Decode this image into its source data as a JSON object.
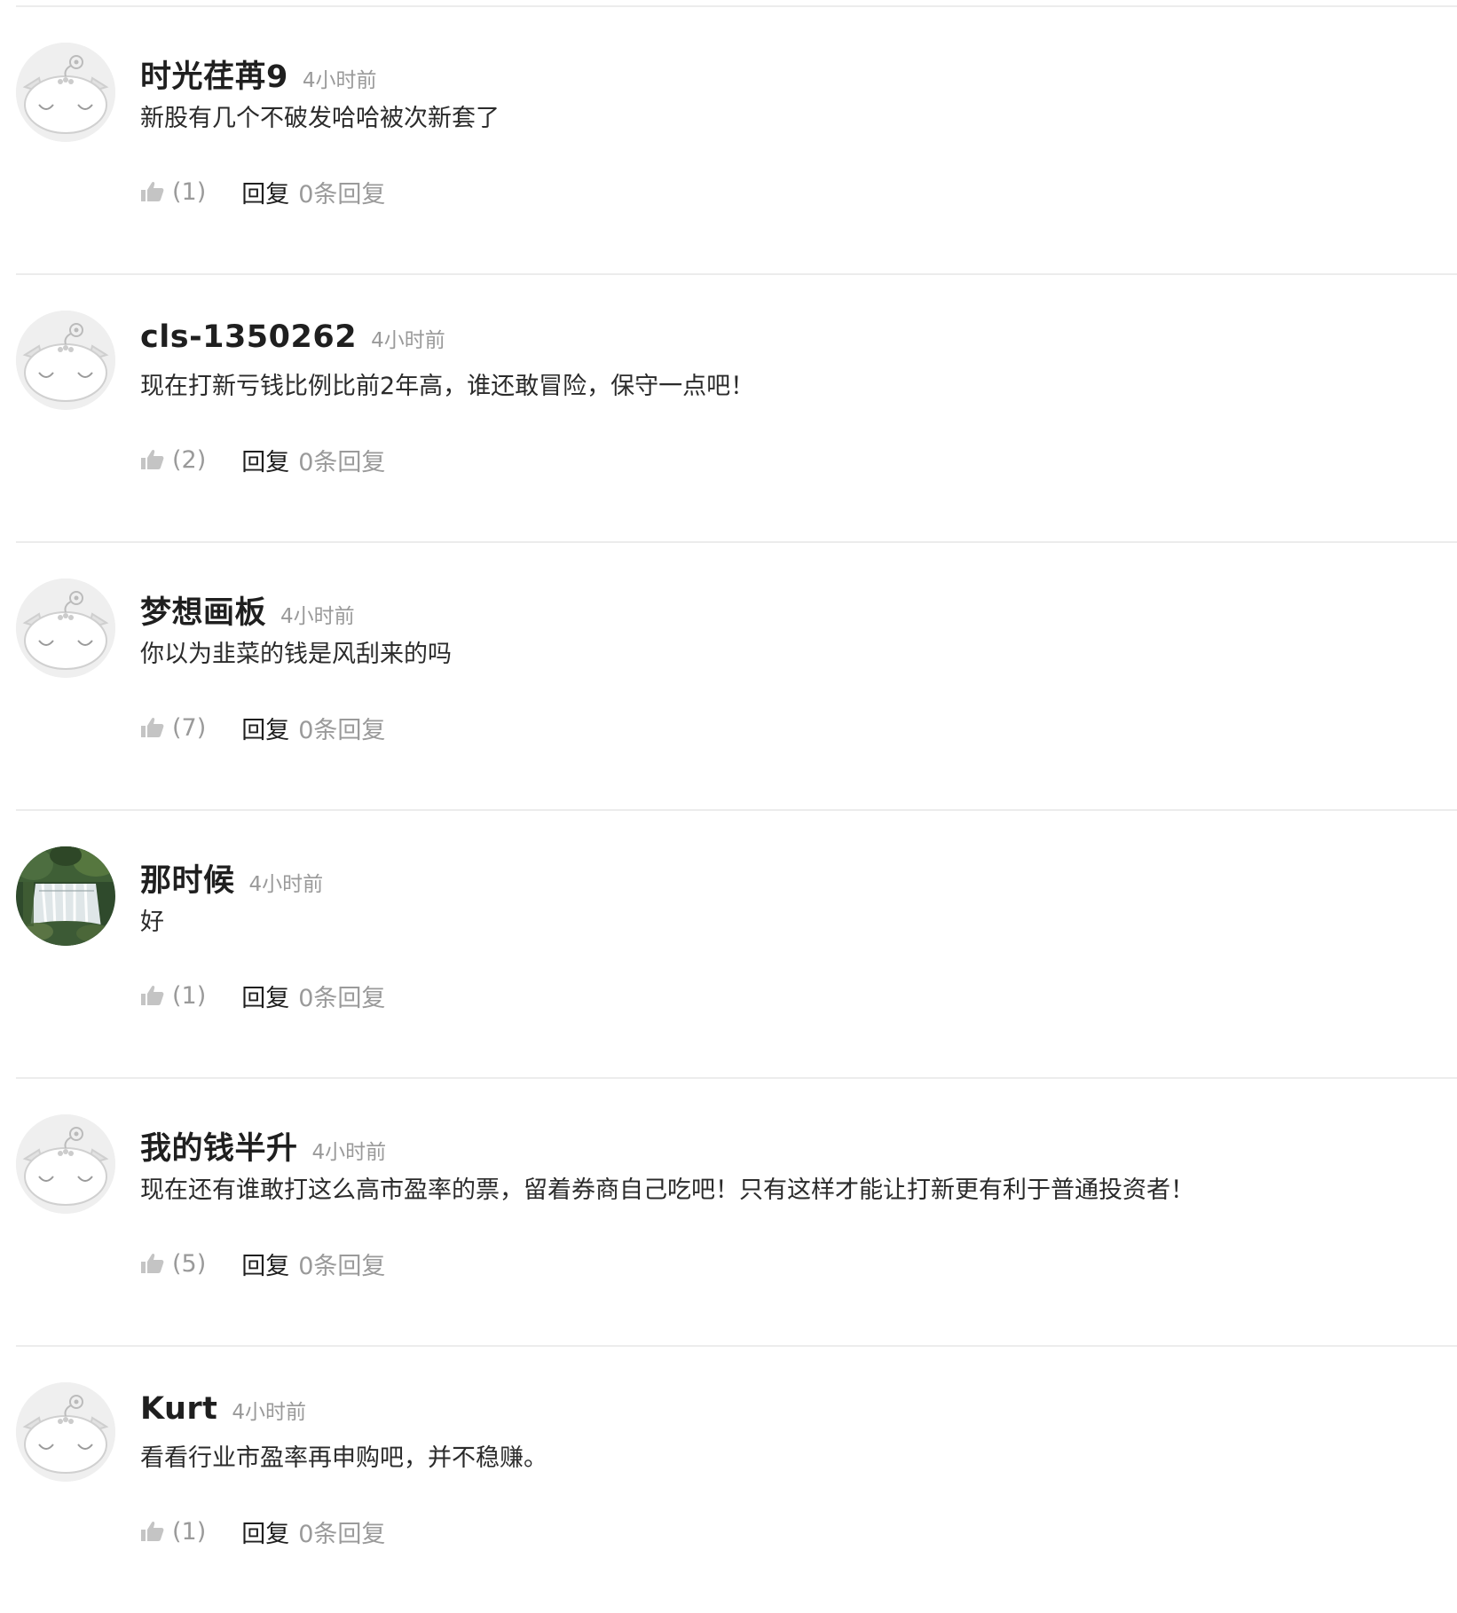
{
  "comments": [
    {
      "username": "时光荏苒9",
      "time": "4小时前",
      "text": "新股有几个不破发哈哈被次新套了",
      "likes": "(1)",
      "reply_label": "回复",
      "reply_count": "0条回复",
      "avatar": "default-cartoon-avatar"
    },
    {
      "username": "cls-1350262",
      "time": "4小时前",
      "text": "现在打新亏钱比例比前2年高，谁还敢冒险，保守一点吧！",
      "likes": "(2)",
      "reply_label": "回复",
      "reply_count": "0条回复",
      "avatar": "default-cartoon-avatar"
    },
    {
      "username": "梦想画板",
      "time": "4小时前",
      "text": "你以为韭菜的钱是风刮来的吗",
      "likes": "(7)",
      "reply_label": "回复",
      "reply_count": "0条回复",
      "avatar": "default-cartoon-avatar"
    },
    {
      "username": "那时候",
      "time": "4小时前",
      "text": "好",
      "likes": "(1)",
      "reply_label": "回复",
      "reply_count": "0条回复",
      "avatar": "waterfall-photo-avatar"
    },
    {
      "username": "我的钱半升",
      "time": "4小时前",
      "text": "现在还有谁敢打这么高市盈率的票，留着券商自己吃吧！只有这样才能让打新更有利于普通投资者！",
      "likes": "(5)",
      "reply_label": "回复",
      "reply_count": "0条回复",
      "avatar": "default-cartoon-avatar"
    },
    {
      "username": "Kurt",
      "time": "4小时前",
      "text": "看看行业市盈率再申购吧，并不稳赚。",
      "likes": "(1)",
      "reply_label": "回复",
      "reply_count": "0条回复",
      "avatar": "default-cartoon-avatar"
    }
  ],
  "colors": {
    "divider": "#ececec",
    "username": "#1f1f1f",
    "muted": "#9a9a9a",
    "text": "#2b2b2b",
    "avatar_bg": "#efefef"
  }
}
